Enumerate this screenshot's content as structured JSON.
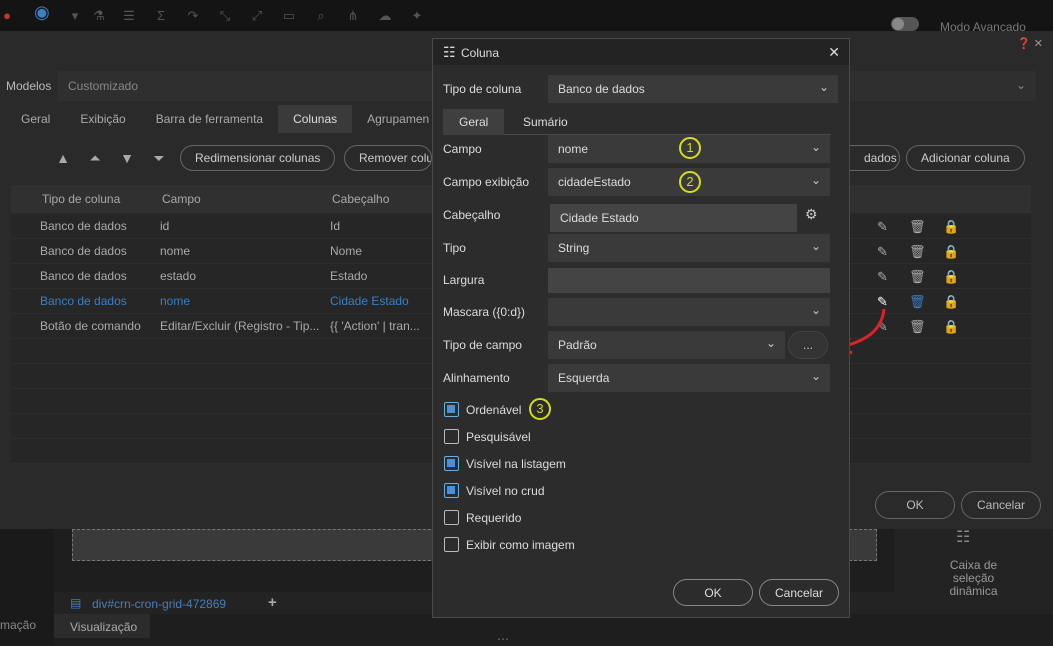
{
  "toolbar": {
    "mode_label": "Modo Avançado"
  },
  "background": {
    "modelos_label": "Modelos",
    "modelos_value": "Customizado",
    "tabs": [
      "Geral",
      "Exibição",
      "Barra de ferramenta",
      "Colunas",
      "Agrupamen"
    ],
    "buttons": {
      "resize": "Redimensionar colunas",
      "remove": "Remover colu",
      "dados": "dados",
      "add": "Adicionar coluna"
    },
    "grid_headers": [
      "Tipo de coluna",
      "Campo",
      "Cabeçalho"
    ],
    "rows": [
      [
        "Banco de dados",
        "id",
        "Id"
      ],
      [
        "Banco de dados",
        "nome",
        "Nome"
      ],
      [
        "Banco de dados",
        "estado",
        "Estado"
      ],
      [
        "Banco de dados",
        "nome",
        "Cidade Estado"
      ],
      [
        "Botão de comando",
        "Editar/Excluir (Registro - Tip...",
        "{{ 'Action' | tran..."
      ]
    ],
    "ok": "OK",
    "cancel": "Cancelar"
  },
  "bottom": {
    "caixa": "Caixa de seleção dinâmica",
    "tab_name": "div#crn-cron-grid-472869",
    "visualizacao": "Visualização",
    "macao": "mação"
  },
  "dialog": {
    "title": "Coluna",
    "tipo_coluna_label": "Tipo de coluna",
    "tipo_coluna_value": "Banco de dados",
    "tabs": [
      "Geral",
      "Sumário"
    ],
    "fields": {
      "campo_label": "Campo",
      "campo_value": "nome",
      "campo_exibicao_label": "Campo exibição",
      "campo_exibicao_value": "cidadeEstado",
      "cabecalho_label": "Cabeçalho",
      "cabecalho_value": "Cidade Estado",
      "tipo_label": "Tipo",
      "tipo_value": "String",
      "largura_label": "Largura",
      "largura_value": "",
      "mascara_label": "Mascara ({0:d})",
      "mascara_value": "",
      "tipo_campo_label": "Tipo de campo",
      "tipo_campo_value": "Padrão",
      "alinhamento_label": "Alinhamento",
      "alinhamento_value": "Esquerda",
      "dots_label": "..."
    },
    "checkboxes": [
      {
        "label": "Ordenável",
        "checked": true
      },
      {
        "label": "Pesquisável",
        "checked": false
      },
      {
        "label": "Visível na listagem",
        "checked": true
      },
      {
        "label": "Visível no crud",
        "checked": true
      },
      {
        "label": "Requerido",
        "checked": false
      },
      {
        "label": "Exibir como imagem",
        "checked": false
      }
    ],
    "annotations": [
      "1",
      "2",
      "3"
    ],
    "ok": "OK",
    "cancel": "Cancelar"
  },
  "colors": {
    "accent": "#4a90d9",
    "annotation": "#d6dd1a",
    "arrow": "#e0212a",
    "selected_row": "#3b7fc4"
  }
}
